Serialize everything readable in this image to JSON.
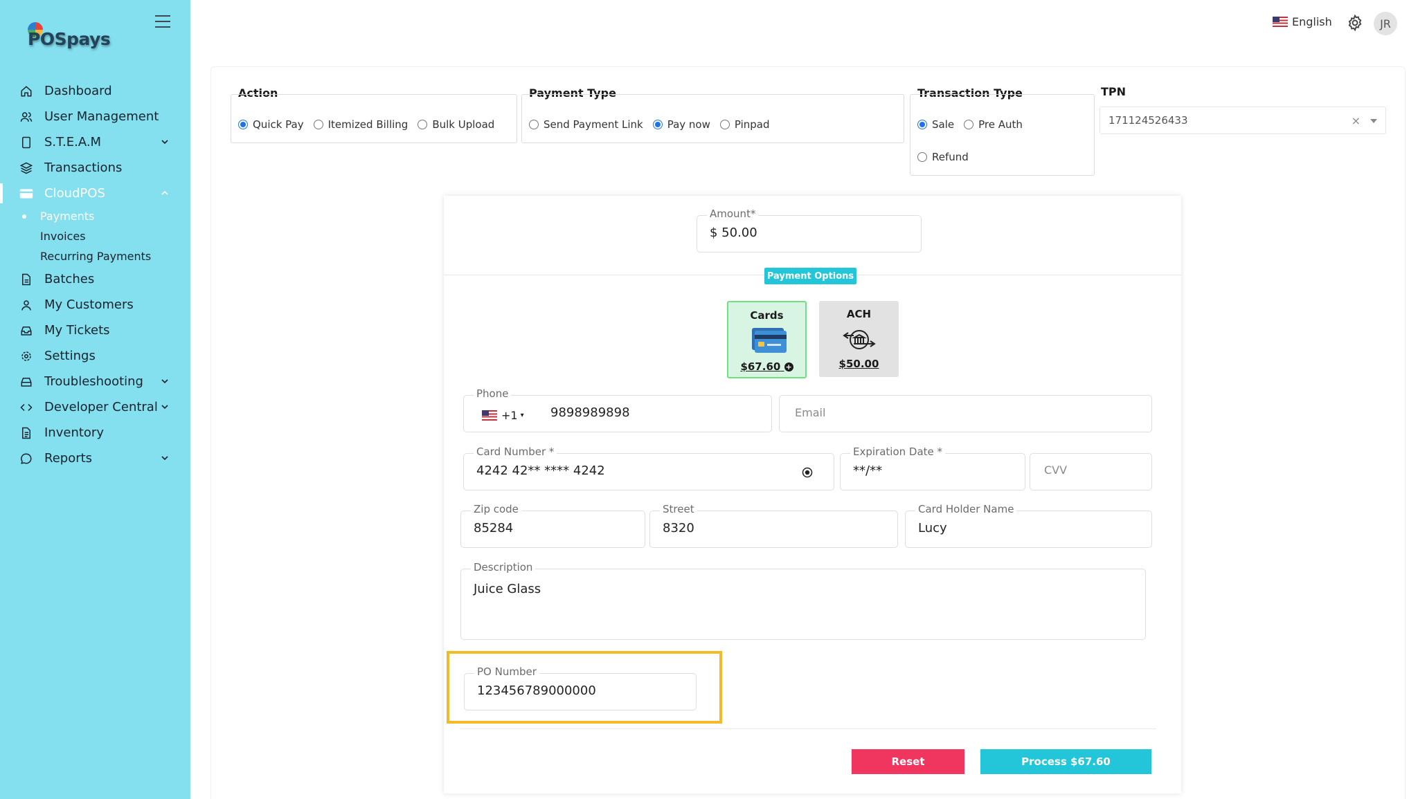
{
  "brand": {
    "logo_text": "POSpays"
  },
  "sidebar": {
    "items": [
      {
        "label": "Dashboard"
      },
      {
        "label": "User Management"
      },
      {
        "label": "S.T.E.A.M"
      },
      {
        "label": "Transactions"
      },
      {
        "label": "CloudPOS"
      },
      {
        "label": "Batches"
      },
      {
        "label": "My Customers"
      },
      {
        "label": "My Tickets"
      },
      {
        "label": "Settings"
      },
      {
        "label": "Troubleshooting"
      },
      {
        "label": "Developer Central"
      },
      {
        "label": "Inventory"
      },
      {
        "label": "Reports"
      }
    ],
    "cloudpos_sub": [
      {
        "label": "Payments"
      },
      {
        "label": "Invoices"
      },
      {
        "label": "Recurring Payments"
      }
    ]
  },
  "topbar": {
    "language": "English",
    "avatar_initials": "JR"
  },
  "action": {
    "title": "Action",
    "options": [
      "Quick Pay",
      "Itemized Billing",
      "Bulk Upload"
    ],
    "selected": "Quick Pay"
  },
  "payment_type": {
    "title": "Payment Type",
    "options": [
      "Send Payment Link",
      "Pay now",
      "Pinpad"
    ],
    "selected": "Pay now"
  },
  "transaction_type": {
    "title": "Transaction Type",
    "options": [
      "Sale",
      "Pre Auth",
      "Refund"
    ],
    "selected": "Sale"
  },
  "tpn": {
    "title": "TPN",
    "value": "171124526433",
    "clear": "×"
  },
  "amount": {
    "label": "Amount*",
    "value": "$ 50.00"
  },
  "payment_options": {
    "label": "Payment Options",
    "cards": {
      "title": "Cards",
      "amount": "$67.60"
    },
    "ach": {
      "title": "ACH",
      "amount": "$50.00"
    }
  },
  "phone": {
    "label": "Phone",
    "country_code": "+1",
    "value": "9898989898"
  },
  "email": {
    "placeholder": "Email"
  },
  "card_number": {
    "label": "Card Number *",
    "value": "4242 42** **** 4242"
  },
  "expiration": {
    "label": "Expiration Date *",
    "value": "**/**"
  },
  "cvv": {
    "placeholder": "CVV"
  },
  "zip": {
    "label": "Zip code",
    "value": "85284"
  },
  "street": {
    "label": "Street",
    "value": "8320"
  },
  "holder": {
    "label": "Card Holder Name",
    "value": "Lucy"
  },
  "description": {
    "label": "Description",
    "value": "Juice Glass"
  },
  "po_number": {
    "label": "PO Number",
    "value": "123456789000000"
  },
  "buttons": {
    "reset": "Reset",
    "process": "Process $67.60"
  },
  "colors": {
    "sidebar_bg": "#84dfee",
    "accent": "#23c6d8",
    "reset": "#f0365f",
    "highlight": "#f3bb2a",
    "selected_card": "#6fe07f"
  }
}
